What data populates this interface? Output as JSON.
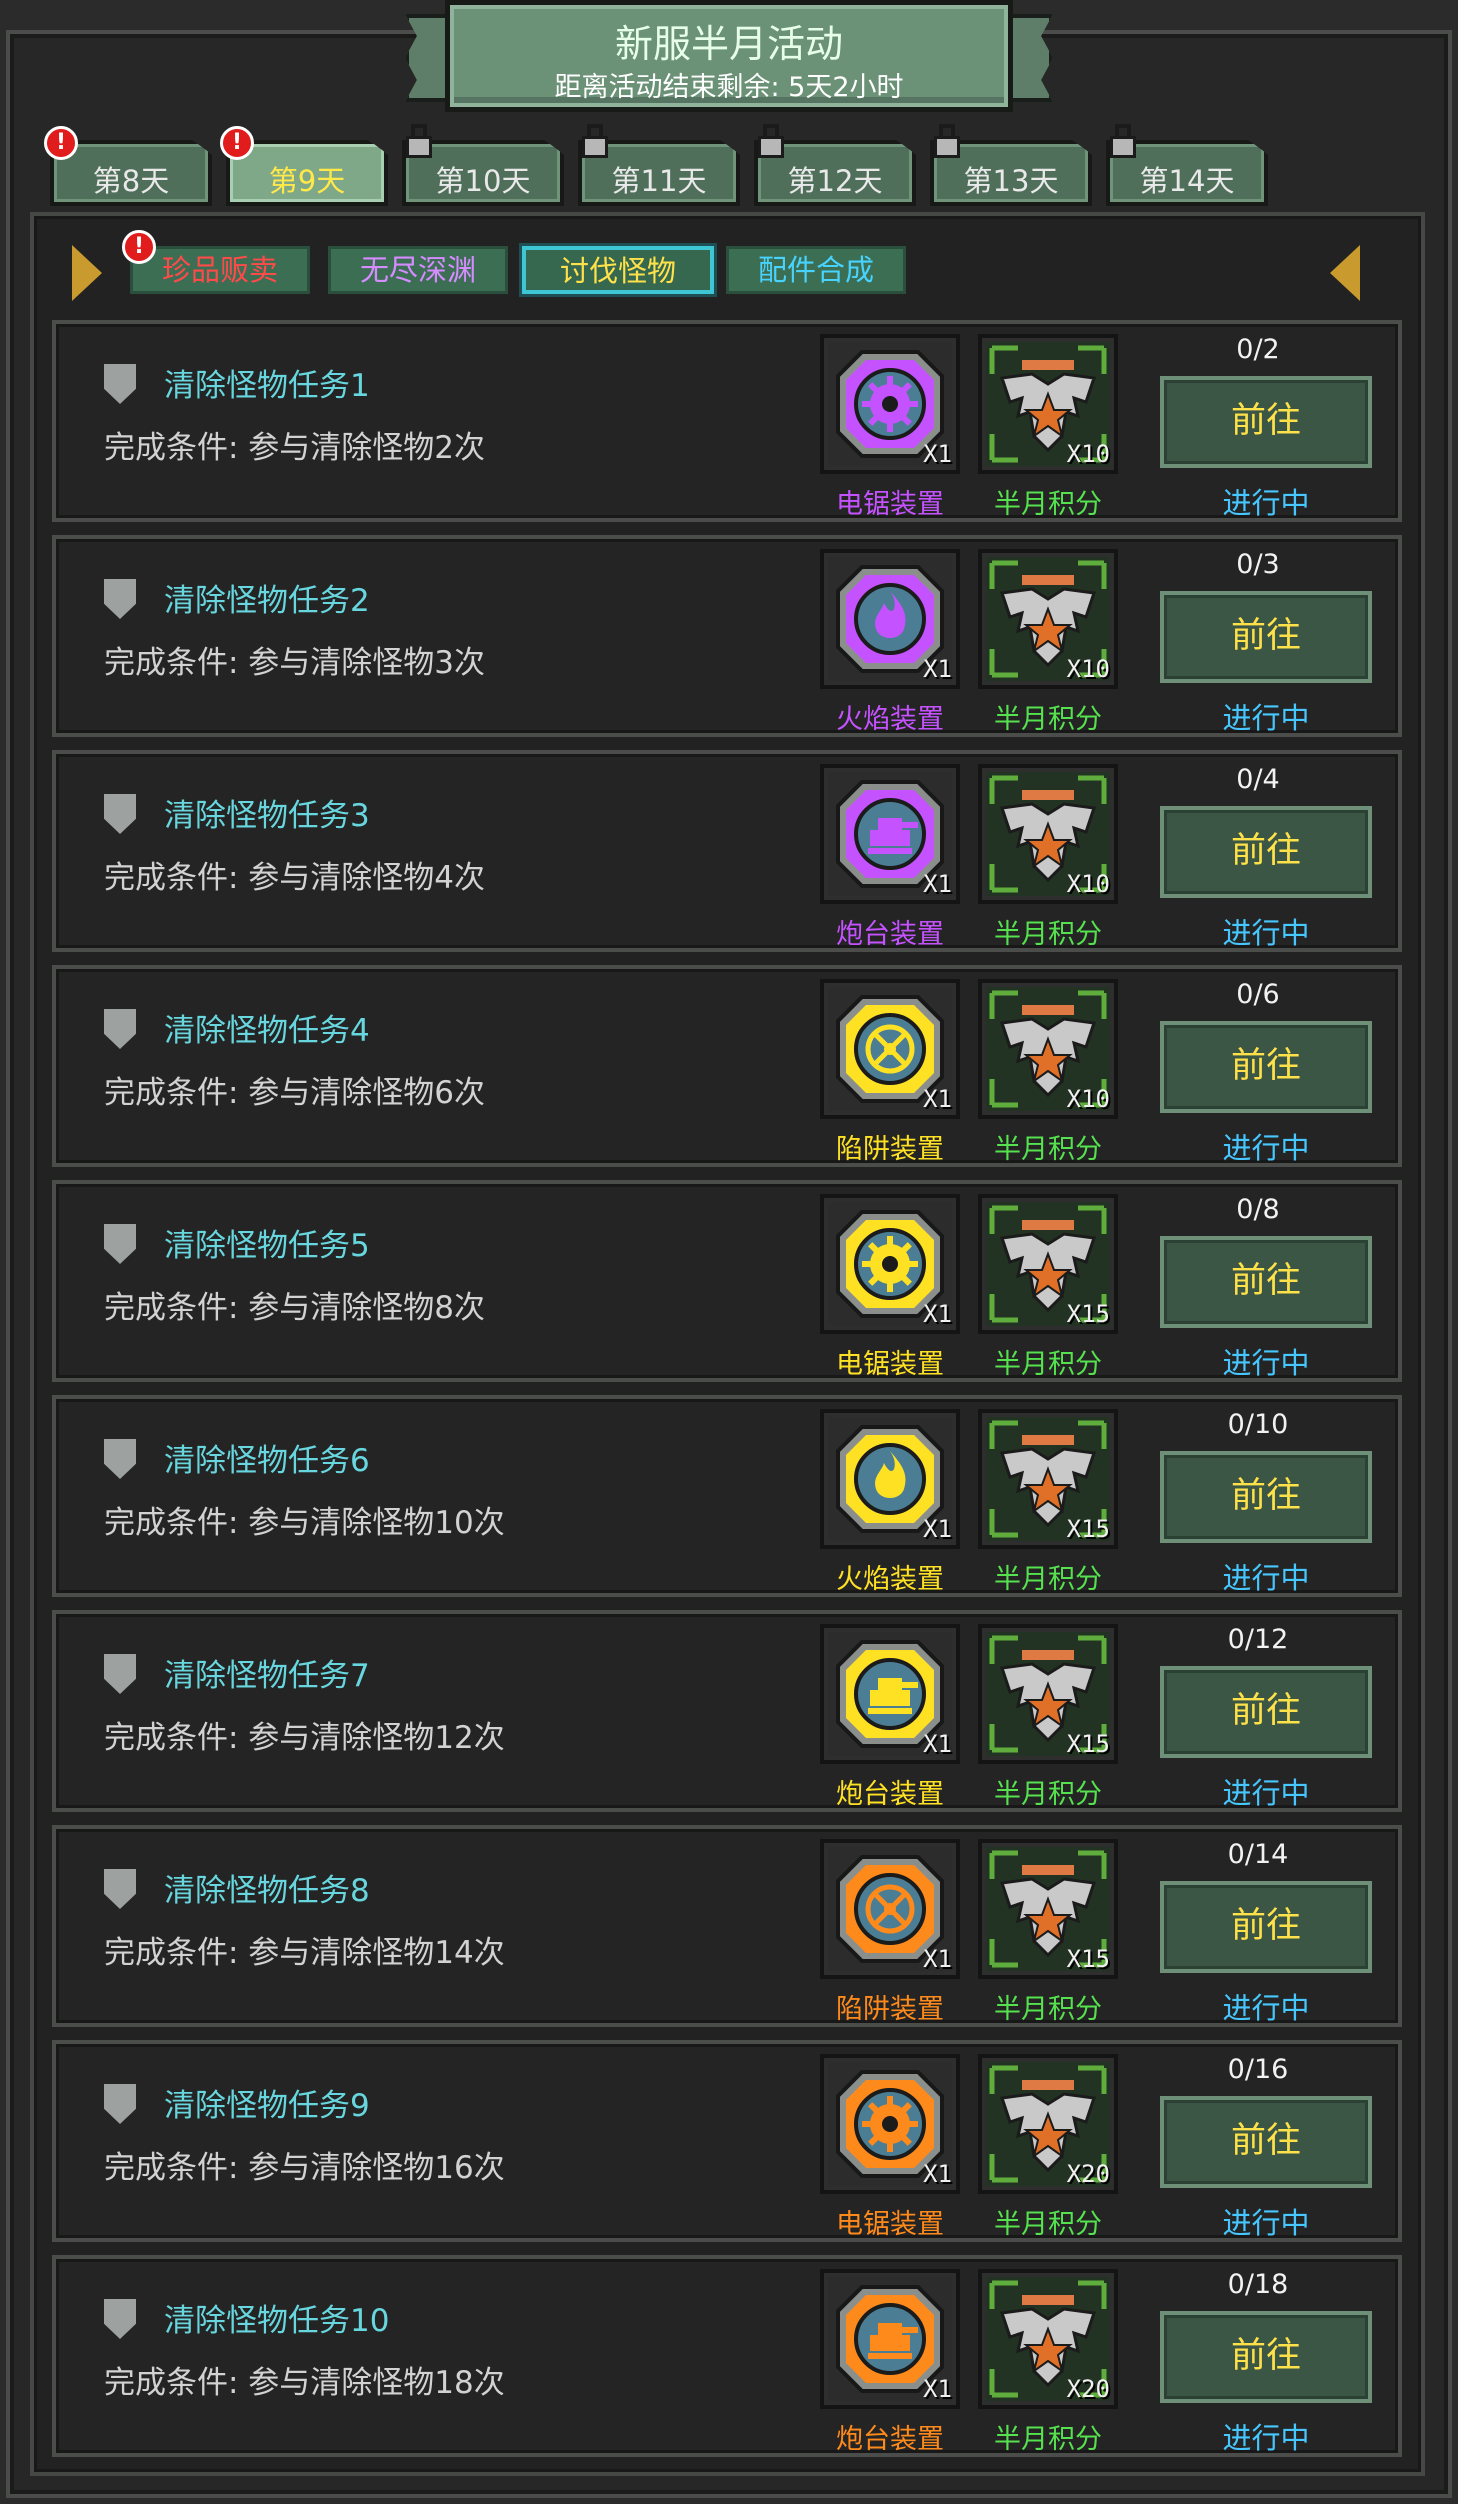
{
  "banner": {
    "title": "新服半月活动",
    "subtitle": "距离活动结束剩余: 5天2小时"
  },
  "tabs": [
    {
      "label": "第8天",
      "locked": false,
      "active": false,
      "badge": "!"
    },
    {
      "label": "第9天",
      "locked": false,
      "active": true,
      "badge": "!"
    },
    {
      "label": "第10天",
      "locked": true,
      "active": false
    },
    {
      "label": "第11天",
      "locked": true,
      "active": false
    },
    {
      "label": "第12天",
      "locked": true,
      "active": false
    },
    {
      "label": "第13天",
      "locked": true,
      "active": false
    },
    {
      "label": "第14天",
      "locked": true,
      "active": false
    }
  ],
  "subtabs": [
    {
      "label": "珍品贩卖",
      "color": "#ff4a4a",
      "badge": "!"
    },
    {
      "label": "无尽深渊",
      "color": "#d58cff"
    },
    {
      "label": "讨伐怪物",
      "color": "#ffe14a",
      "selected": true
    },
    {
      "label": "配件合成",
      "color": "#48d3ff"
    }
  ],
  "tasks": [
    {
      "title": "清除怪物任务1",
      "condition": "完成条件: 参与清除怪物2次",
      "progress": "0/2",
      "button": "前往",
      "status": "进行中",
      "reward1": {
        "name": "电锯装置",
        "qty": "X1",
        "color": "#c552ff",
        "icon": "saw-icon"
      },
      "reward2": {
        "name": "半月积分",
        "qty": "X10",
        "icon": "eagle-badge-icon"
      }
    },
    {
      "title": "清除怪物任务2",
      "condition": "完成条件: 参与清除怪物3次",
      "progress": "0/3",
      "button": "前往",
      "status": "进行中",
      "reward1": {
        "name": "火焰装置",
        "qty": "X1",
        "color": "#c552ff",
        "icon": "flame-icon"
      },
      "reward2": {
        "name": "半月积分",
        "qty": "X10",
        "icon": "eagle-badge-icon"
      }
    },
    {
      "title": "清除怪物任务3",
      "condition": "完成条件: 参与清除怪物4次",
      "progress": "0/4",
      "button": "前往",
      "status": "进行中",
      "reward1": {
        "name": "炮台装置",
        "qty": "X1",
        "color": "#c552ff",
        "icon": "turret-icon"
      },
      "reward2": {
        "name": "半月积分",
        "qty": "X10",
        "icon": "eagle-badge-icon"
      }
    },
    {
      "title": "清除怪物任务4",
      "condition": "完成条件: 参与清除怪物6次",
      "progress": "0/6",
      "button": "前往",
      "status": "进行中",
      "reward1": {
        "name": "陷阱装置",
        "qty": "X1",
        "color": "#ffe124",
        "icon": "trap-icon"
      },
      "reward2": {
        "name": "半月积分",
        "qty": "X10",
        "icon": "eagle-badge-icon"
      }
    },
    {
      "title": "清除怪物任务5",
      "condition": "完成条件: 参与清除怪物8次",
      "progress": "0/8",
      "button": "前往",
      "status": "进行中",
      "reward1": {
        "name": "电锯装置",
        "qty": "X1",
        "color": "#ffe124",
        "icon": "saw-icon"
      },
      "reward2": {
        "name": "半月积分",
        "qty": "X15",
        "icon": "eagle-badge-icon"
      }
    },
    {
      "title": "清除怪物任务6",
      "condition": "完成条件: 参与清除怪物10次",
      "progress": "0/10",
      "button": "前往",
      "status": "进行中",
      "reward1": {
        "name": "火焰装置",
        "qty": "X1",
        "color": "#ffe124",
        "icon": "flame-icon"
      },
      "reward2": {
        "name": "半月积分",
        "qty": "X15",
        "icon": "eagle-badge-icon"
      }
    },
    {
      "title": "清除怪物任务7",
      "condition": "完成条件: 参与清除怪物12次",
      "progress": "0/12",
      "button": "前往",
      "status": "进行中",
      "reward1": {
        "name": "炮台装置",
        "qty": "X1",
        "color": "#ffe124",
        "icon": "turret-icon"
      },
      "reward2": {
        "name": "半月积分",
        "qty": "X15",
        "icon": "eagle-badge-icon"
      }
    },
    {
      "title": "清除怪物任务8",
      "condition": "完成条件: 参与清除怪物14次",
      "progress": "0/14",
      "button": "前往",
      "status": "进行中",
      "reward1": {
        "name": "陷阱装置",
        "qty": "X1",
        "color": "#ff8a1c",
        "icon": "trap-icon"
      },
      "reward2": {
        "name": "半月积分",
        "qty": "X15",
        "icon": "eagle-badge-icon"
      }
    },
    {
      "title": "清除怪物任务9",
      "condition": "完成条件: 参与清除怪物16次",
      "progress": "0/16",
      "button": "前往",
      "status": "进行中",
      "reward1": {
        "name": "电锯装置",
        "qty": "X1",
        "color": "#ff8a1c",
        "icon": "saw-icon"
      },
      "reward2": {
        "name": "半月积分",
        "qty": "X20",
        "icon": "eagle-badge-icon"
      }
    },
    {
      "title": "清除怪物任务10",
      "condition": "完成条件: 参与清除怪物18次",
      "progress": "0/18",
      "button": "前往",
      "status": "进行中",
      "reward1": {
        "name": "炮台装置",
        "qty": "X1",
        "color": "#ff8a1c",
        "icon": "turret-icon"
      },
      "reward2": {
        "name": "半月积分",
        "qty": "X20",
        "icon": "eagle-badge-icon"
      }
    }
  ]
}
